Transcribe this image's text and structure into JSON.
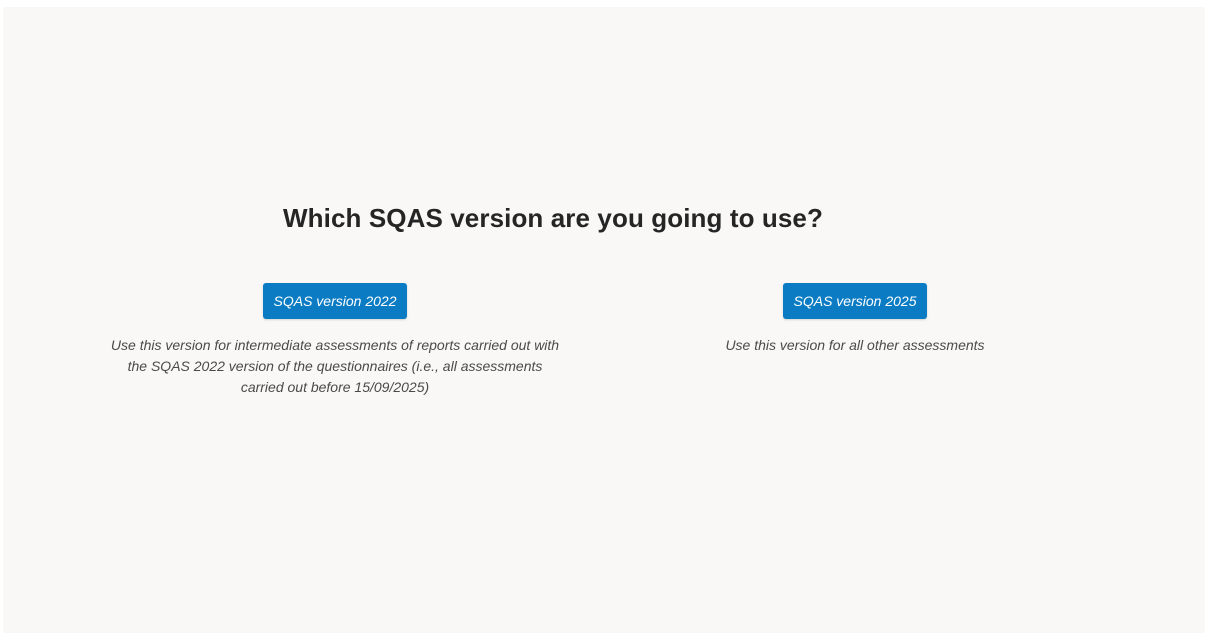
{
  "heading": "Which SQAS version are you going to use?",
  "options": [
    {
      "button_label": "SQAS version 2022",
      "description": "Use this version for intermediate assessments of reports carried out with the SQAS 2022 version of the questionnaires (i.e., all assessments carried out before 15/09/2025)"
    },
    {
      "button_label": "SQAS version 2025",
      "description": "Use this version for all other assessments"
    }
  ],
  "colors": {
    "button_bg": "#0b7cc4",
    "page_bg": "#f9f8f7",
    "heading_text": "#252525",
    "description_text": "#4a4a4a"
  }
}
